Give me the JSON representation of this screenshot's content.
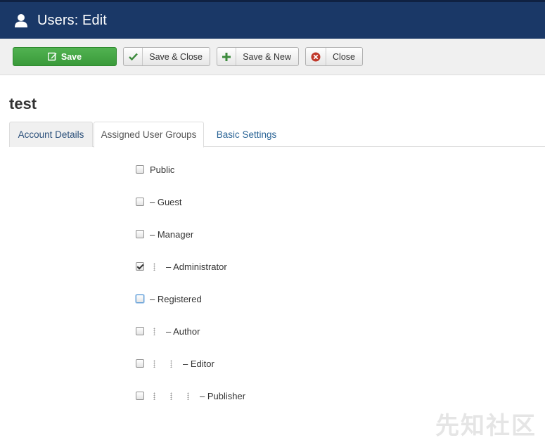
{
  "header": {
    "title": "Users: Edit",
    "icon": "user-icon"
  },
  "toolbar": {
    "save_label": "Save",
    "save_close_label": "Save & Close",
    "save_new_label": "Save & New",
    "close_label": "Close",
    "colors": {
      "save_bg": "#46a546",
      "check": "#3c8a3c",
      "plus": "#3c8a3c",
      "close": "#c0392b"
    }
  },
  "page": {
    "title": "test"
  },
  "tabs": [
    {
      "label": "Account Details",
      "active": false
    },
    {
      "label": "Assigned User Groups",
      "active": true
    },
    {
      "label": "Basic Settings",
      "active": false
    }
  ],
  "groups": [
    {
      "label": "Public",
      "level": 0,
      "checked": false
    },
    {
      "label": "– Guest",
      "level": 0,
      "checked": false
    },
    {
      "label": "– Manager",
      "level": 0,
      "checked": false
    },
    {
      "label": "– Administrator",
      "level": 1,
      "checked": true
    },
    {
      "label": "– Registered",
      "level": 0,
      "checked": false,
      "focused": true
    },
    {
      "label": "– Author",
      "level": 1,
      "checked": false
    },
    {
      "label": "– Editor",
      "level": 2,
      "checked": false
    },
    {
      "label": "– Publisher",
      "level": 3,
      "checked": false
    }
  ],
  "watermark": "先知社区"
}
